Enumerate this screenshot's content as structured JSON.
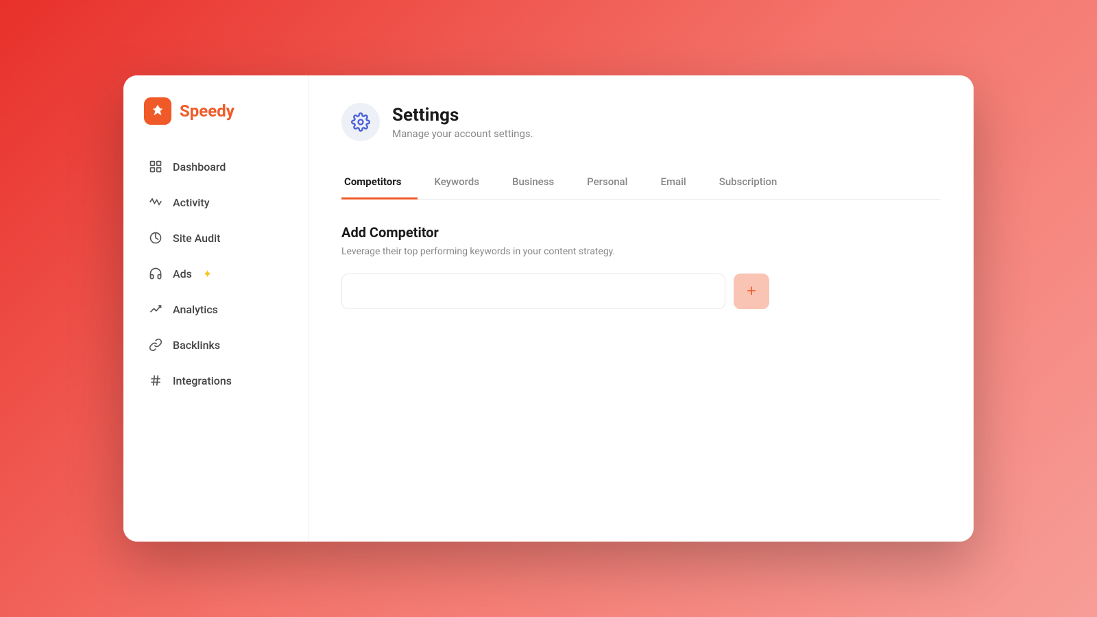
{
  "app": {
    "name": "Speedy"
  },
  "sidebar": {
    "items": [
      {
        "id": "dashboard",
        "label": "Dashboard",
        "icon": "dashboard-icon"
      },
      {
        "id": "activity",
        "label": "Activity",
        "icon": "activity-icon"
      },
      {
        "id": "site-audit",
        "label": "Site Audit",
        "icon": "site-audit-icon"
      },
      {
        "id": "ads",
        "label": "Ads",
        "icon": "ads-icon",
        "badge": "✦"
      },
      {
        "id": "analytics",
        "label": "Analytics",
        "icon": "analytics-icon"
      },
      {
        "id": "backlinks",
        "label": "Backlinks",
        "icon": "backlinks-icon"
      },
      {
        "id": "integrations",
        "label": "Integrations",
        "icon": "integrations-icon"
      }
    ]
  },
  "page": {
    "title": "Settings",
    "subtitle": "Manage your account settings.",
    "tabs": [
      {
        "id": "competitors",
        "label": "Competitors",
        "active": true
      },
      {
        "id": "keywords",
        "label": "Keywords",
        "active": false
      },
      {
        "id": "business",
        "label": "Business",
        "active": false
      },
      {
        "id": "personal",
        "label": "Personal",
        "active": false
      },
      {
        "id": "email",
        "label": "Email",
        "active": false
      },
      {
        "id": "subscription",
        "label": "Subscription",
        "active": false
      }
    ]
  },
  "competitors_section": {
    "title": "Add Competitor",
    "description": "Leverage their top performing keywords in your content strategy.",
    "input_placeholder": "",
    "add_button_label": "+"
  }
}
